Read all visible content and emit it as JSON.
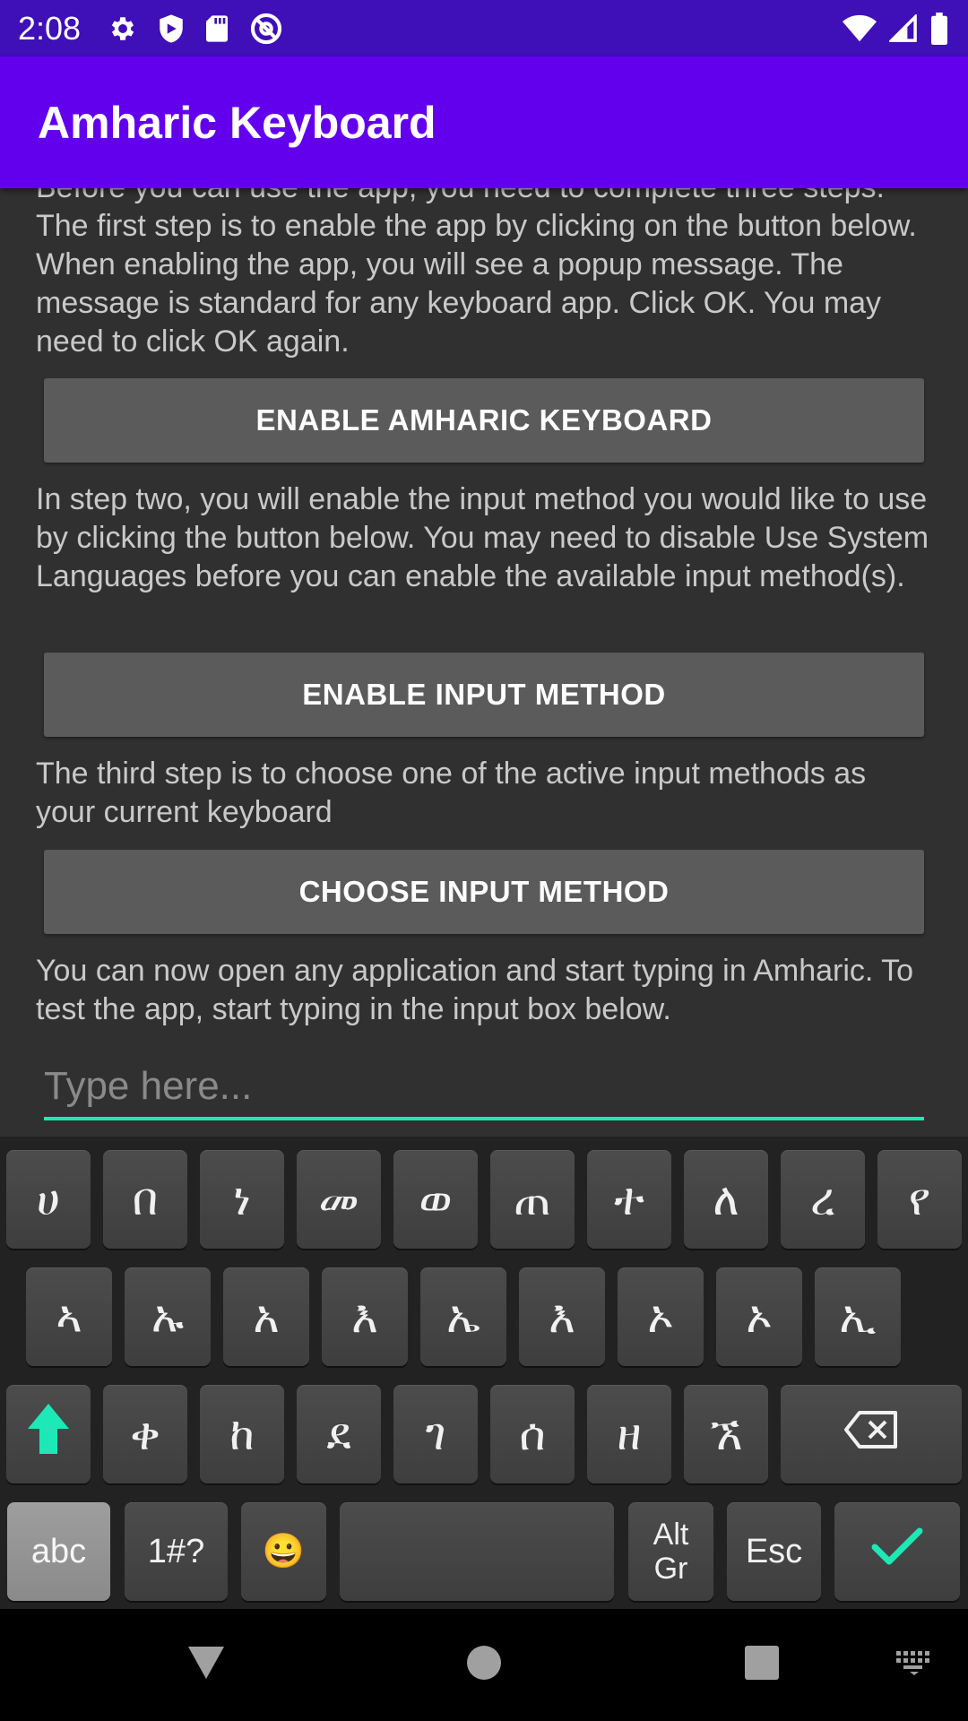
{
  "colors": {
    "status_bar": "#3f0fb8",
    "app_bar": "#6200ee",
    "accent": "#1de9b6"
  },
  "status_bar": {
    "time": "2:08",
    "left_icons": [
      "gear-icon",
      "shield-icon",
      "sd-card-icon",
      "at-sign-icon"
    ],
    "right_icons": [
      "wifi-icon",
      "signal-icon",
      "battery-icon"
    ]
  },
  "app_bar": {
    "title": "Amharic Keyboard"
  },
  "main": {
    "para1": "Before you can use the app, you need to complete three steps. The first step is to enable the app by clicking on the button below. When enabling the app, you will see a popup message. The message is standard for any keyboard app. Click OK. You may need to click OK again.",
    "button1": "ENABLE AMHARIC KEYBOARD",
    "para2": "In step two, you will enable the input method you would like to use by clicking the button below. You may need to disable Use System Languages before you can enable the available input method(s).",
    "button2": "ENABLE INPUT METHOD",
    "para3": "The third step is to choose one of the active input methods as your current keyboard",
    "button3": "CHOOSE INPUT METHOD",
    "para4": "You can now open any application and start typing in Amharic. To test the app, start typing in the input box below.",
    "input_placeholder": "Type here..."
  },
  "keyboard": {
    "row1": [
      "ሀ",
      "በ",
      "ነ",
      "መ",
      "ወ",
      "ጠ",
      "ተ",
      "ለ",
      "ረ",
      "የ"
    ],
    "row2": [
      "ኣ",
      "ኡ",
      "አ",
      "እ",
      "ኤ",
      "እ",
      "ኦ",
      "ኦ",
      "ኢ"
    ],
    "row3": [
      "ቀ",
      "ከ",
      "ደ",
      "ገ",
      "ሰ",
      "ዘ",
      "ኧ"
    ],
    "row4": {
      "abc": "abc",
      "symbols": "1#?",
      "emoji": "😀",
      "altgr_line1": "Alt",
      "altgr_line2": "Gr",
      "esc": "Esc"
    }
  },
  "nav_bar": {
    "icons": [
      "back-icon",
      "home-icon",
      "recents-icon",
      "keyboard-switch-icon"
    ]
  }
}
